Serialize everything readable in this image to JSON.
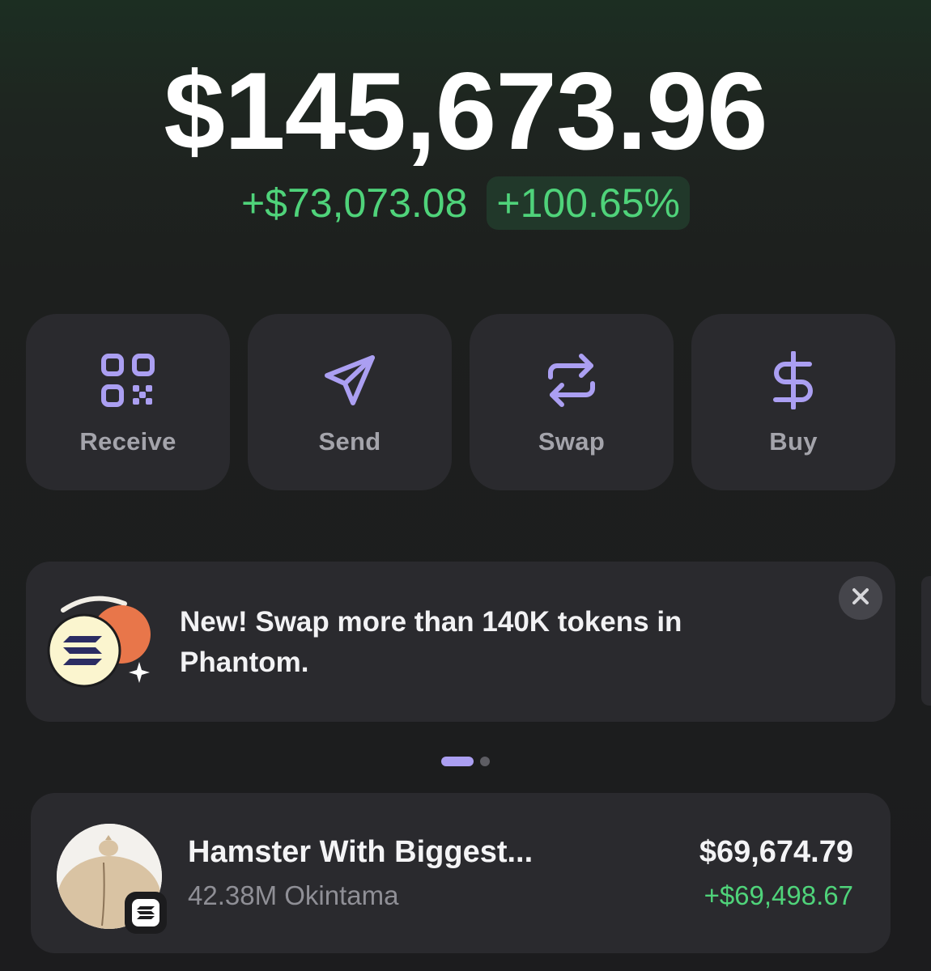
{
  "portfolio": {
    "balance": "$145,673.96",
    "change_amount": "+$73,073.08",
    "change_percent": "+100.65%"
  },
  "actions": [
    {
      "label": "Receive",
      "icon": "qr-code-icon"
    },
    {
      "label": "Send",
      "icon": "paper-plane-icon"
    },
    {
      "label": "Swap",
      "icon": "swap-arrows-icon"
    },
    {
      "label": "Buy",
      "icon": "dollar-icon"
    }
  ],
  "banner": {
    "text": "New! Swap more than 140K tokens in Phantom.",
    "icon": "solana-coin-icon",
    "close_icon": "close-icon"
  },
  "carousel": {
    "active_index": 0,
    "count": 2
  },
  "tokens": [
    {
      "name": "Hamster With Biggest...",
      "quantity": "42.38M Okintama",
      "value": "$69,674.79",
      "change": "+$69,498.67",
      "chain_icon": "solana-icon"
    }
  ],
  "colors": {
    "accent": "#ab9ff2",
    "positive": "#4fd37a",
    "card": "#2a2a2e",
    "background": "#1c1c1e"
  }
}
